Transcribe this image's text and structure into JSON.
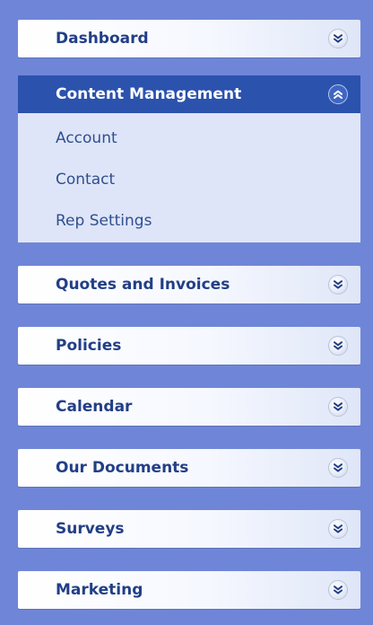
{
  "sidebar": {
    "sections": [
      {
        "label": "Dashboard",
        "expanded": false,
        "icon": "chevron-down-icon"
      },
      {
        "label": "Content Management",
        "expanded": true,
        "icon": "chevron-up-icon",
        "items": [
          {
            "label": "Account"
          },
          {
            "label": "Contact"
          },
          {
            "label": "Rep Settings"
          }
        ]
      },
      {
        "label": "Quotes and Invoices",
        "expanded": false,
        "icon": "chevron-down-icon"
      },
      {
        "label": "Policies",
        "expanded": false,
        "icon": "chevron-down-icon"
      },
      {
        "label": "Calendar",
        "expanded": false,
        "icon": "chevron-down-icon"
      },
      {
        "label": "Our Documents",
        "expanded": false,
        "icon": "chevron-down-icon"
      },
      {
        "label": "Surveys",
        "expanded": false,
        "icon": "chevron-down-icon"
      },
      {
        "label": "Marketing",
        "expanded": false,
        "icon": "chevron-down-icon"
      }
    ]
  },
  "colors": {
    "background": "#6f86d8",
    "active_header": "#2b52ad",
    "header_text": "#223f86",
    "submenu_background": "#dfe5f8",
    "submenu_text": "#2f4f8f"
  }
}
